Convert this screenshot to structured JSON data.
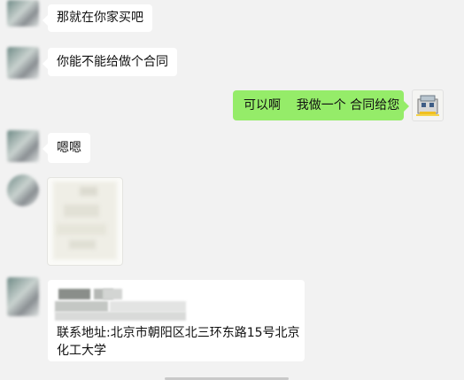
{
  "messages": [
    {
      "side": "left",
      "text": "那就在你家买吧"
    },
    {
      "side": "left",
      "text": "你能不能给做个合同"
    },
    {
      "side": "right",
      "text": "可以啊    我做一个 合同给您"
    },
    {
      "side": "left",
      "text": "嗯嗯"
    },
    {
      "side": "left",
      "type": "image"
    },
    {
      "side": "left",
      "type": "card",
      "text": "联系地址:北京市朝阳区北三环东路15号北京化工大学"
    }
  ],
  "colors": {
    "background": "#f2f2f2",
    "bubble_in": "#ffffff",
    "bubble_out": "#95ec69"
  }
}
